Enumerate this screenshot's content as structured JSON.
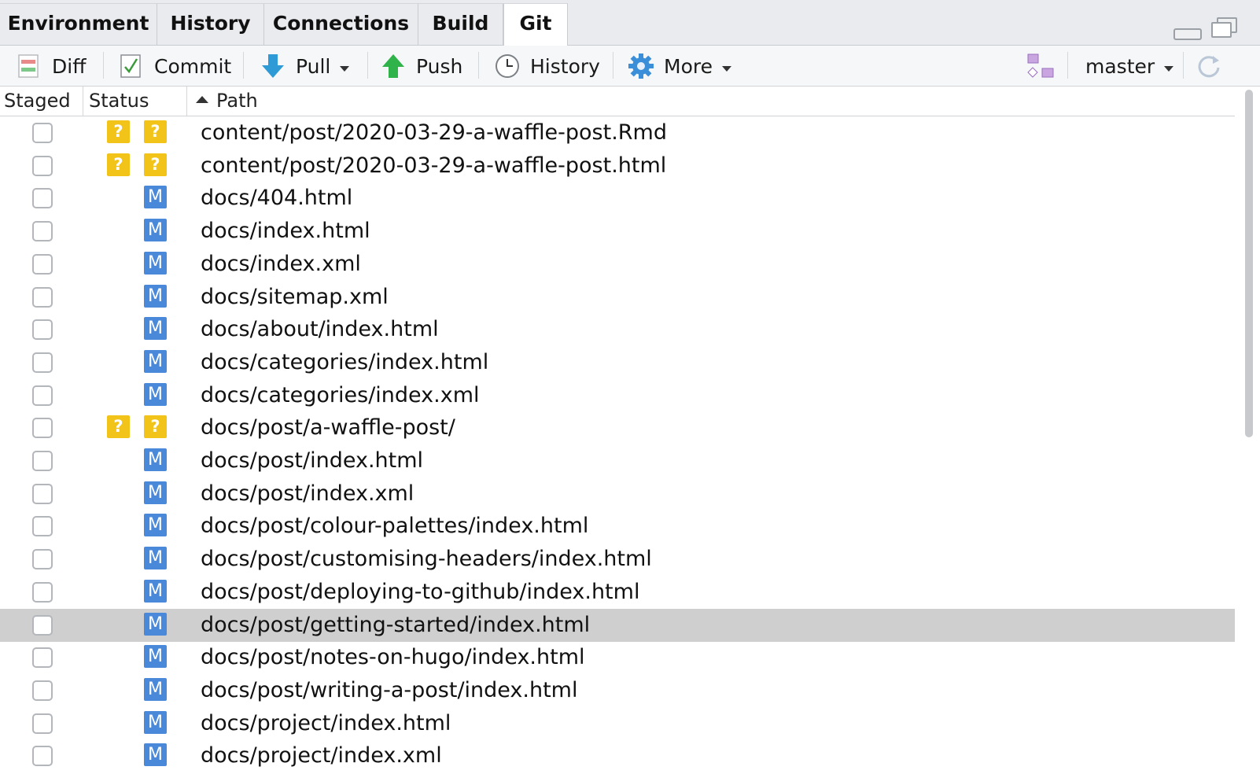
{
  "tabs": [
    {
      "label": "Environment",
      "active": false
    },
    {
      "label": "History",
      "active": false
    },
    {
      "label": "Connections",
      "active": false
    },
    {
      "label": "Build",
      "active": false
    },
    {
      "label": "Git",
      "active": true
    }
  ],
  "toolbar": {
    "diff_label": "Diff",
    "commit_label": "Commit",
    "pull_label": "Pull",
    "push_label": "Push",
    "history_label": "History",
    "more_label": "More",
    "branch_label": "master"
  },
  "columns": {
    "staged": "Staged",
    "status": "Status",
    "path": "Path"
  },
  "rows": [
    {
      "staged": false,
      "status1": "?",
      "status2": "?",
      "path": "content/post/2020-03-29-a-waffle-post.Rmd"
    },
    {
      "staged": false,
      "status1": "?",
      "status2": "?",
      "path": "content/post/2020-03-29-a-waffle-post.html"
    },
    {
      "staged": false,
      "status1": "",
      "status2": "M",
      "path": "docs/404.html"
    },
    {
      "staged": false,
      "status1": "",
      "status2": "M",
      "path": "docs/index.html"
    },
    {
      "staged": false,
      "status1": "",
      "status2": "M",
      "path": "docs/index.xml"
    },
    {
      "staged": false,
      "status1": "",
      "status2": "M",
      "path": "docs/sitemap.xml"
    },
    {
      "staged": false,
      "status1": "",
      "status2": "M",
      "path": "docs/about/index.html"
    },
    {
      "staged": false,
      "status1": "",
      "status2": "M",
      "path": "docs/categories/index.html"
    },
    {
      "staged": false,
      "status1": "",
      "status2": "M",
      "path": "docs/categories/index.xml"
    },
    {
      "staged": false,
      "status1": "?",
      "status2": "?",
      "path": "docs/post/a-waffle-post/"
    },
    {
      "staged": false,
      "status1": "",
      "status2": "M",
      "path": "docs/post/index.html"
    },
    {
      "staged": false,
      "status1": "",
      "status2": "M",
      "path": "docs/post/index.xml"
    },
    {
      "staged": false,
      "status1": "",
      "status2": "M",
      "path": "docs/post/colour-palettes/index.html"
    },
    {
      "staged": false,
      "status1": "",
      "status2": "M",
      "path": "docs/post/customising-headers/index.html"
    },
    {
      "staged": false,
      "status1": "",
      "status2": "M",
      "path": "docs/post/deploying-to-github/index.html"
    },
    {
      "staged": false,
      "status1": "",
      "status2": "M",
      "path": "docs/post/getting-started/index.html",
      "selected": true
    },
    {
      "staged": false,
      "status1": "",
      "status2": "M",
      "path": "docs/post/notes-on-hugo/index.html"
    },
    {
      "staged": false,
      "status1": "",
      "status2": "M",
      "path": "docs/post/writing-a-post/index.html"
    },
    {
      "staged": false,
      "status1": "",
      "status2": "M",
      "path": "docs/project/index.html"
    },
    {
      "staged": false,
      "status1": "",
      "status2": "M",
      "path": "docs/project/index.xml"
    }
  ],
  "colors": {
    "untracked": "#f2c318",
    "modified": "#4a88d9",
    "selected_row": "#cfcfcf",
    "push_green": "#2fb34a",
    "pull_blue": "#2f9bd6"
  }
}
